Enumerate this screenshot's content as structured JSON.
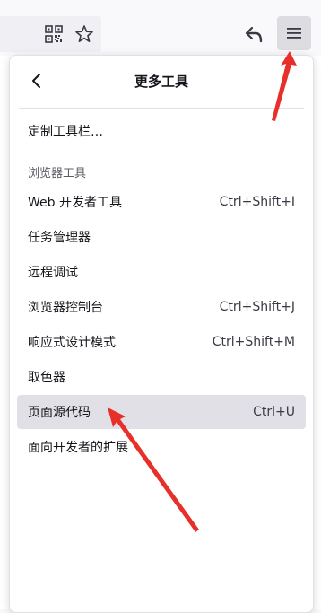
{
  "toolbar": {
    "icons": [
      "qr-code-icon",
      "bookmark-star-icon",
      "back-arrow-icon",
      "hamburger-menu-icon"
    ]
  },
  "panel": {
    "title": "更多工具",
    "customize_label": "定制工具栏…",
    "section_label": "浏览器工具",
    "items": [
      {
        "label": "Web 开发者工具",
        "shortcut": "Ctrl+Shift+I"
      },
      {
        "label": "任务管理器",
        "shortcut": ""
      },
      {
        "label": "远程调试",
        "shortcut": ""
      },
      {
        "label": "浏览器控制台",
        "shortcut": "Ctrl+Shift+J"
      },
      {
        "label": "响应式设计模式",
        "shortcut": "Ctrl+Shift+M"
      },
      {
        "label": "取色器",
        "shortcut": ""
      },
      {
        "label": "页面源代码",
        "shortcut": "Ctrl+U"
      },
      {
        "label": "面向开发者的扩展",
        "shortcut": ""
      }
    ]
  },
  "colors": {
    "annotation_arrow": "#e8302a",
    "hover_bg": "#e0e0e6",
    "menu_button_bg": "#dcdce1"
  }
}
